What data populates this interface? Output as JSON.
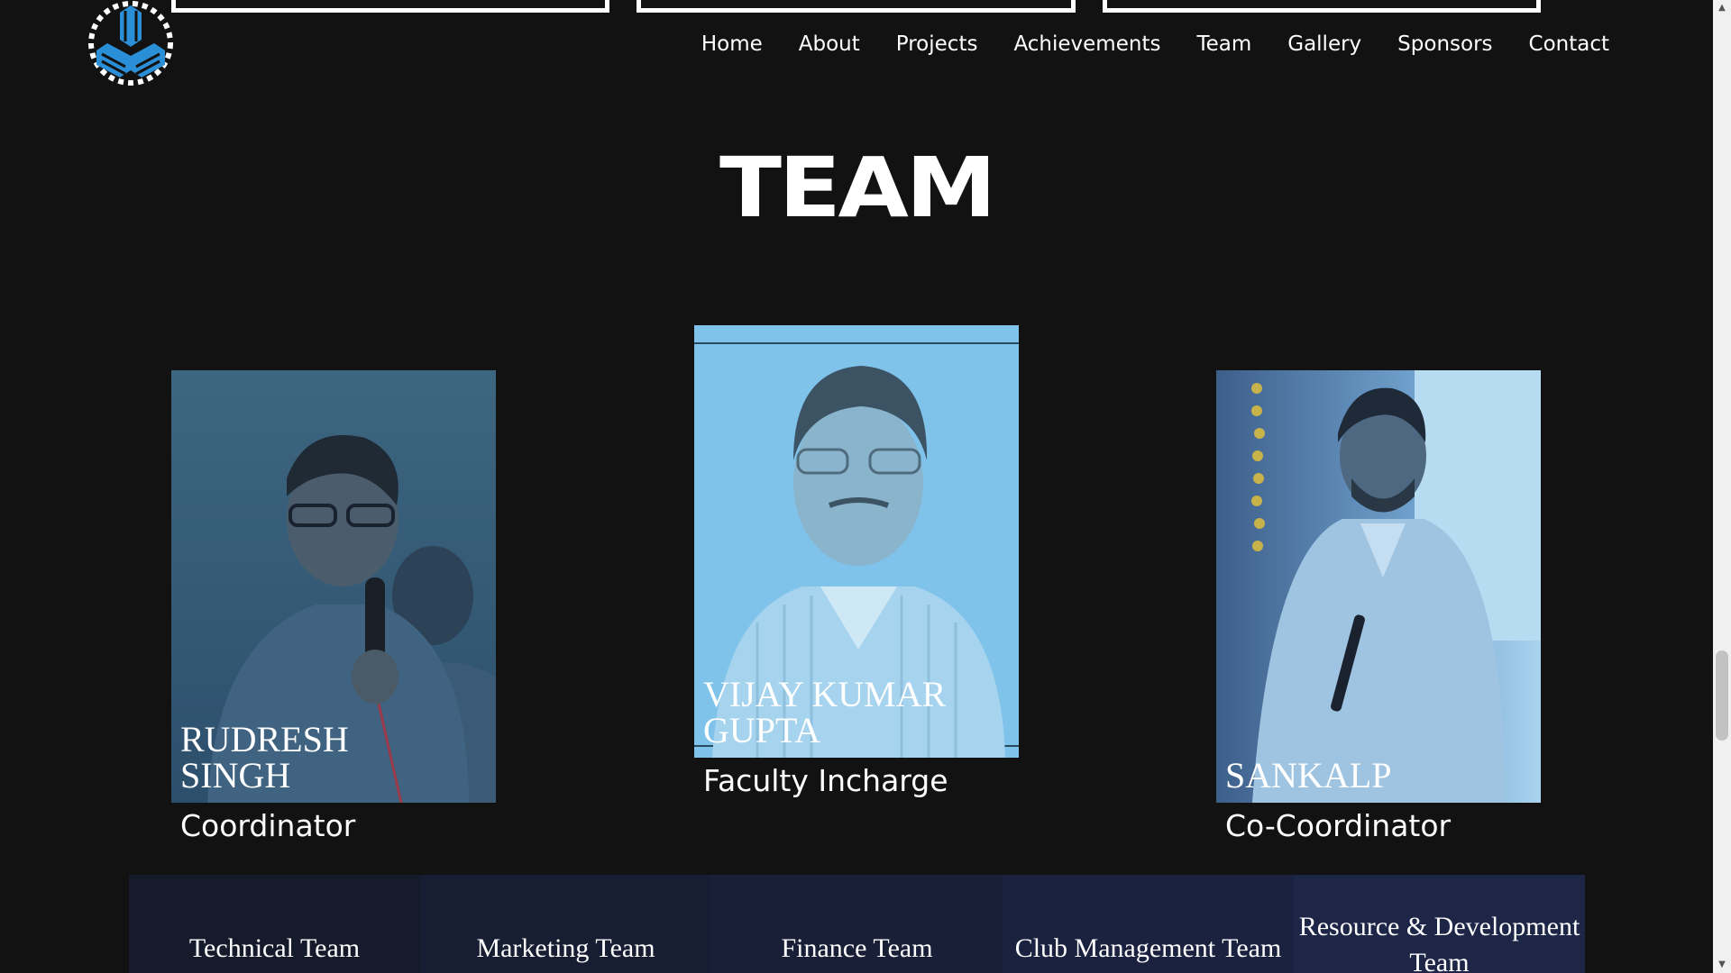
{
  "nav": {
    "items": [
      {
        "label": "Home"
      },
      {
        "label": "About"
      },
      {
        "label": "Projects"
      },
      {
        "label": "Achievements"
      },
      {
        "label": "Team"
      },
      {
        "label": "Gallery"
      },
      {
        "label": "Sponsors"
      },
      {
        "label": "Contact"
      }
    ]
  },
  "section": {
    "title": "TEAM"
  },
  "members": [
    {
      "name": "RUDRESH SINGH",
      "role": "Coordinator"
    },
    {
      "name": "VIJAY KUMAR GUPTA",
      "role": "Faculty Incharge"
    },
    {
      "name": "SANKALP",
      "role": "Co-Coordinator"
    }
  ],
  "tabs": [
    {
      "label": "Technical Team"
    },
    {
      "label": "Marketing Team"
    },
    {
      "label": "Finance Team"
    },
    {
      "label": "Club Management Team"
    },
    {
      "label": "Resource & Development Team"
    }
  ],
  "colors": {
    "background": "#121212",
    "logo_blue": "#2a8fd6",
    "photo_tint": "#7fc3ea"
  },
  "icons": {
    "logo": "gear-cube-logo-icon"
  }
}
